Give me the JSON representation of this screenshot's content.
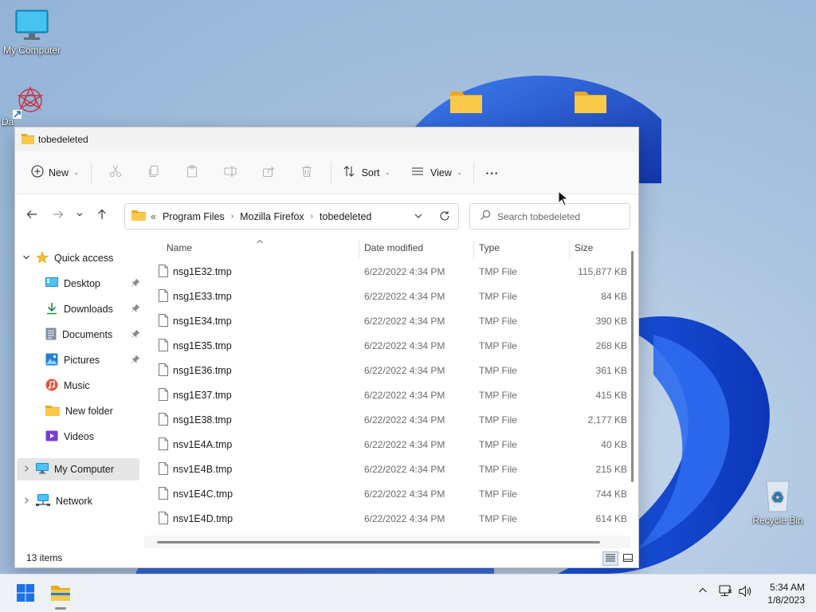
{
  "desktop": {
    "icons": [
      {
        "label": "My Computer"
      },
      {
        "label": "Da"
      },
      {
        "label": "Recycle Bin"
      }
    ]
  },
  "window": {
    "title": "tobedeleted",
    "toolbar": {
      "new_label": "New",
      "sort_label": "Sort",
      "view_label": "View",
      "more_label": "···"
    },
    "breadcrumb": {
      "overflow": "«",
      "parts": [
        "Program Files",
        "Mozilla Firefox",
        "tobedeleted"
      ]
    },
    "search": {
      "placeholder": "Search tobedeleted"
    },
    "nav": {
      "quick_access": "Quick access",
      "items": [
        {
          "label": "Desktop",
          "pinned": true
        },
        {
          "label": "Downloads",
          "pinned": true
        },
        {
          "label": "Documents",
          "pinned": true
        },
        {
          "label": "Pictures",
          "pinned": true
        },
        {
          "label": "Music",
          "pinned": false
        },
        {
          "label": "New folder",
          "pinned": false
        },
        {
          "label": "Videos",
          "pinned": false
        }
      ],
      "my_computer": "My Computer",
      "network": "Network"
    },
    "columns": {
      "name": "Name",
      "date": "Date modified",
      "type": "Type",
      "size": "Size"
    },
    "files": [
      {
        "name": "nsg1E32.tmp",
        "date": "6/22/2022 4:34 PM",
        "type": "TMP File",
        "size": "115,877 KB"
      },
      {
        "name": "nsg1E33.tmp",
        "date": "6/22/2022 4:34 PM",
        "type": "TMP File",
        "size": "84 KB"
      },
      {
        "name": "nsg1E34.tmp",
        "date": "6/22/2022 4:34 PM",
        "type": "TMP File",
        "size": "390 KB"
      },
      {
        "name": "nsg1E35.tmp",
        "date": "6/22/2022 4:34 PM",
        "type": "TMP File",
        "size": "268 KB"
      },
      {
        "name": "nsg1E36.tmp",
        "date": "6/22/2022 4:34 PM",
        "type": "TMP File",
        "size": "361 KB"
      },
      {
        "name": "nsg1E37.tmp",
        "date": "6/22/2022 4:34 PM",
        "type": "TMP File",
        "size": "415 KB"
      },
      {
        "name": "nsg1E38.tmp",
        "date": "6/22/2022 4:34 PM",
        "type": "TMP File",
        "size": "2,177 KB"
      },
      {
        "name": "nsv1E4A.tmp",
        "date": "6/22/2022 4:34 PM",
        "type": "TMP File",
        "size": "40 KB"
      },
      {
        "name": "nsv1E4B.tmp",
        "date": "6/22/2022 4:34 PM",
        "type": "TMP File",
        "size": "215 KB"
      },
      {
        "name": "nsv1E4C.tmp",
        "date": "6/22/2022 4:34 PM",
        "type": "TMP File",
        "size": "744 KB"
      },
      {
        "name": "nsv1E4D.tmp",
        "date": "6/22/2022 4:34 PM",
        "type": "TMP File",
        "size": "614 KB"
      }
    ],
    "status": {
      "item_count": "13 items"
    }
  },
  "taskbar": {
    "time": "5:34 AM",
    "date": "1/8/2023"
  },
  "colors": {
    "accent": "#0067c0",
    "folder": "#f8c94a",
    "wallpaper_blue": "#1450d8"
  }
}
